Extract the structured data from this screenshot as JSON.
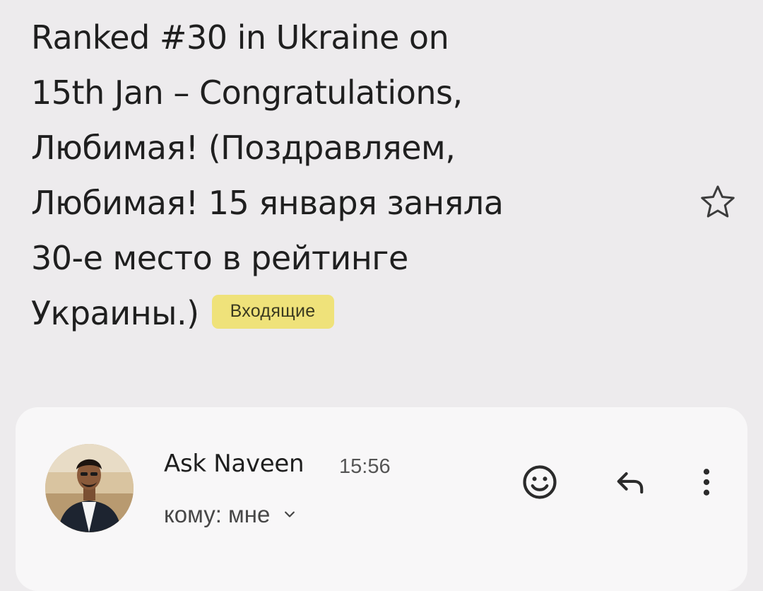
{
  "email": {
    "subject_lines": [
      "Ranked #30 in Ukraine on",
      "15th Jan  – Congratulations,",
      "Любимая! (Поздравляем,",
      "Любимая! 15 января заняла",
      "30-е место в рейтинге",
      "Украины.)"
    ],
    "label": "Входящие",
    "label_color": "#efe27a",
    "starred": false
  },
  "message": {
    "sender_name": "Ask Naveen",
    "time": "15:56",
    "recipient": "кому: мне"
  },
  "icons": {
    "star": "star-outline-icon",
    "emoji": "add-reaction-icon",
    "reply": "reply-icon",
    "more": "more-vert-icon",
    "chevron": "chevron-down-icon"
  }
}
